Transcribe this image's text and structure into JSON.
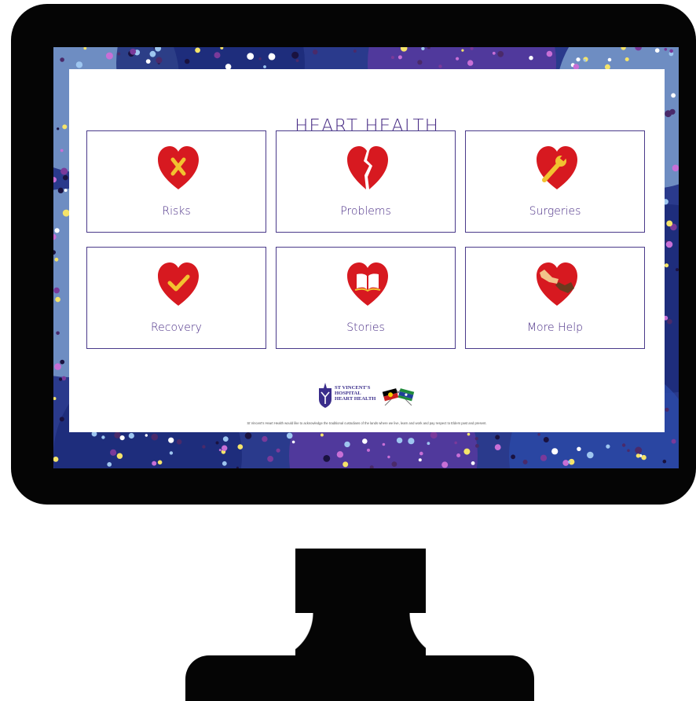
{
  "page_title": "HEART HEALTH",
  "tiles": [
    {
      "label": "Risks",
      "icon": "heart-x-icon"
    },
    {
      "label": "Problems",
      "icon": "broken-heart-icon"
    },
    {
      "label": "Surgeries",
      "icon": "heart-wrench-icon"
    },
    {
      "label": "Recovery",
      "icon": "heart-check-icon"
    },
    {
      "label": "Stories",
      "icon": "heart-book-icon"
    },
    {
      "label": "More Help",
      "icon": "heart-hands-icon"
    }
  ],
  "logo": {
    "line1": "ST VINCENT'S",
    "line2": "HOSPITAL",
    "line3": "HEART HEALTH"
  },
  "acknowledgement": "St Vincent's Heart Health would like to acknowledge the traditional custodians of the lands where we live, learn and work and pay respect to Elders past and present.",
  "colors": {
    "heart": "#d71920",
    "accent": "#f2c230",
    "text": "#4a2e86",
    "border": "#4a3a8a"
  }
}
